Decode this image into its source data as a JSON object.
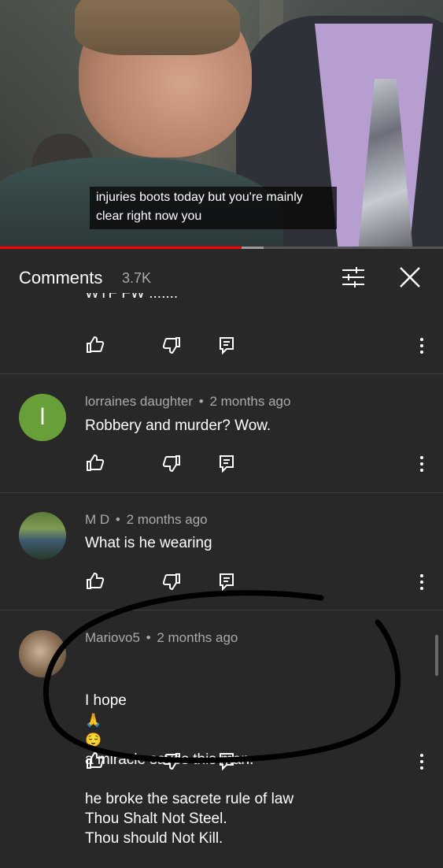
{
  "video": {
    "caption": "injuries boots today but you're mainly\nclear right now you",
    "progress_fraction": 0.545
  },
  "comments_header": {
    "title": "Comments",
    "count": "3.7K",
    "icons": [
      "sort-filter-icon",
      "close-icon"
    ]
  },
  "partial_comment": {
    "text": "WTF FW :::::::"
  },
  "comments": [
    {
      "author": "lorraines daughter",
      "time": "2 months ago",
      "avatar_letter": "l",
      "avatar_color": "#689f38",
      "text": "Robbery and murder? Wow."
    },
    {
      "author": "M D",
      "time": "2 months ago",
      "text": "What is he wearing"
    },
    {
      "author": "Mariovo5",
      "time": "2 months ago",
      "text_line1_a": "I hope",
      "text_line1_emoji1": "🙏",
      "text_line1_emoji2": "😌",
      "text_line1_b": "a miracle saves this man.",
      "text_rest": "he broke the sacrete rule of law\nThou Shalt Not Steel.\nThou should Not Kill."
    }
  ],
  "separator": "•",
  "colors": {
    "background": "#282828",
    "meta_text": "#aaaaaa",
    "progress_played": "#ff0000",
    "annotation_ink": "#000000"
  }
}
